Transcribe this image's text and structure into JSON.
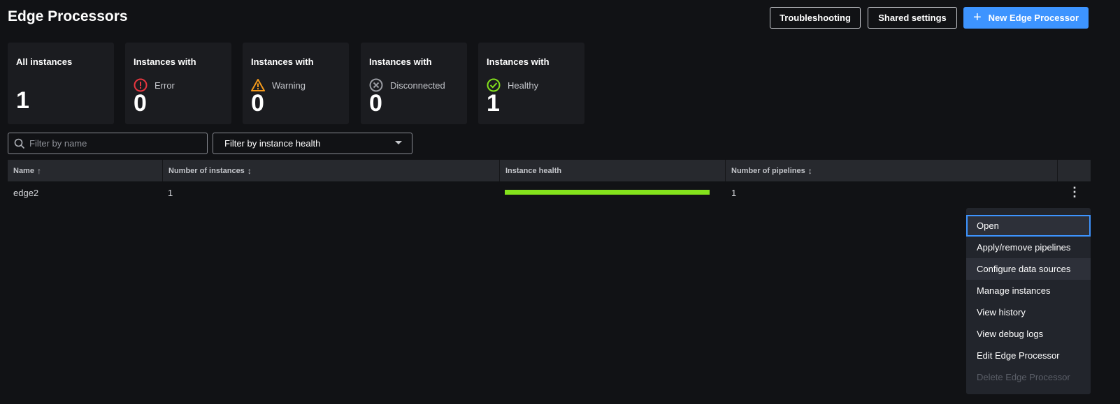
{
  "header": {
    "title": "Edge Processors",
    "troubleshooting": "Troubleshooting",
    "shared_settings": "Shared settings",
    "new_processor": "New Edge Processor"
  },
  "cards": [
    {
      "title": "All instances",
      "status": "",
      "count": "1"
    },
    {
      "title": "Instances with",
      "status": "Error",
      "count": "0",
      "icon": "error-icon",
      "color": "#e8363f"
    },
    {
      "title": "Instances with",
      "status": "Warning",
      "count": "0",
      "icon": "warning-icon",
      "color": "#f59a1b"
    },
    {
      "title": "Instances with",
      "status": "Disconnected",
      "count": "0",
      "icon": "disconnected-icon",
      "color": "#9a9ca3"
    },
    {
      "title": "Instances with",
      "status": "Healthy",
      "count": "1",
      "icon": "healthy-icon",
      "color": "#84e21c"
    }
  ],
  "filters": {
    "name_placeholder": "Filter by name",
    "health_select": "Filter by instance health"
  },
  "table": {
    "columns": [
      "Name",
      "Number of instances",
      "Instance health",
      "Number of pipelines"
    ],
    "rows": [
      {
        "name": "edge2",
        "instances": "1",
        "health_fraction": 1.0,
        "health_color": "#84e21c",
        "pipelines": "1"
      }
    ]
  },
  "menu": {
    "items": [
      "Open",
      "Apply/remove pipelines",
      "Configure data sources",
      "Manage instances",
      "View history",
      "View debug logs",
      "Edit Edge Processor",
      "Delete Edge Processor"
    ],
    "focused": "Open",
    "hovered": "Configure data sources",
    "disabled": "Delete Edge Processor"
  }
}
